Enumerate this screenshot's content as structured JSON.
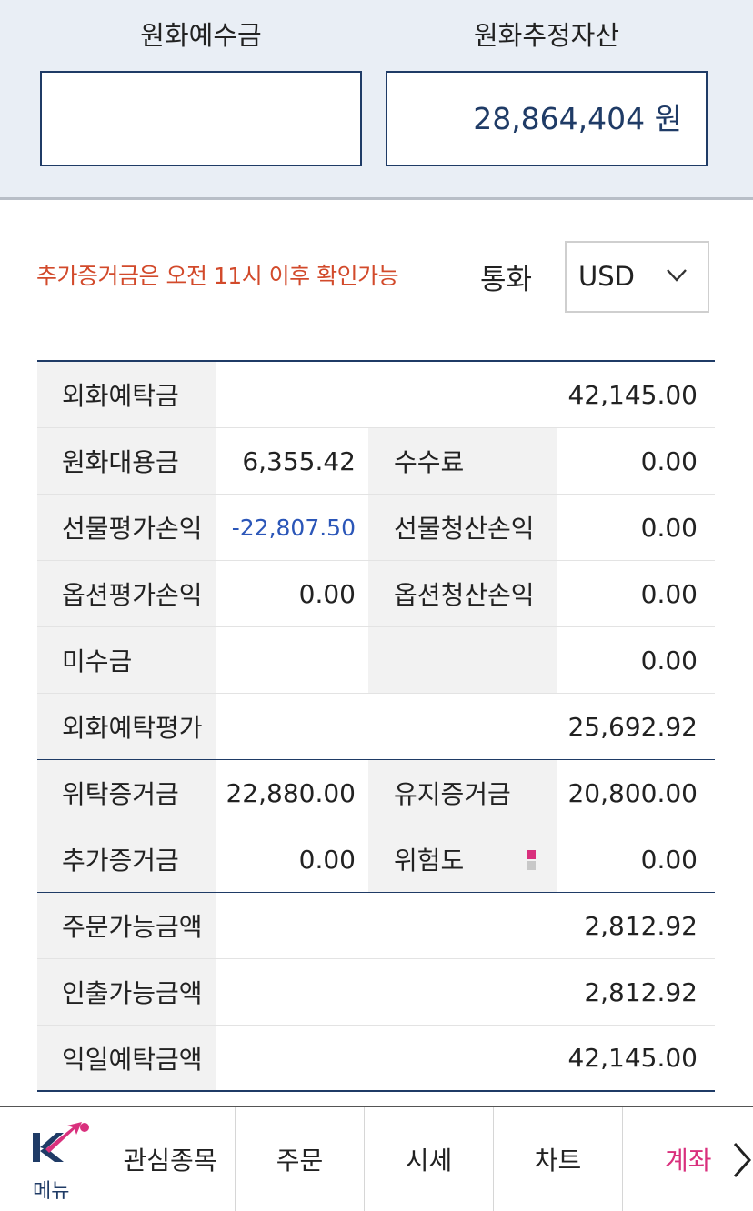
{
  "summary": {
    "krw_deposit_label": "원화예수금",
    "krw_deposit_value": "",
    "krw_est_assets_label": "원화추정자산",
    "krw_est_assets_value": "28,864,404 원"
  },
  "currency_bar": {
    "notice": "추가증거금은 오전 11시 이후 확인가능",
    "label": "통화",
    "selected": "USD",
    "notice_color": "#d24a2b"
  },
  "table": {
    "foreign_deposit": {
      "label": "외화예탁금",
      "value": "42,145.00"
    },
    "krw_substitute": {
      "label": "원화대용금",
      "value": "6,355.42"
    },
    "fee": {
      "label": "수수료",
      "value": "0.00"
    },
    "futures_eval_pl": {
      "label": "선물평가손익",
      "value": "-22,807.50"
    },
    "futures_settle_pl": {
      "label": "선물청산손익",
      "value": "0.00"
    },
    "options_eval_pl": {
      "label": "옵션평가손익",
      "value": "0.00"
    },
    "options_settle_pl": {
      "label": "옵션청산손익",
      "value": "0.00"
    },
    "unpaid": {
      "label": "미수금",
      "value": "0.00"
    },
    "foreign_deposit_eval": {
      "label": "외화예탁평가",
      "value": "25,692.92"
    },
    "initial_margin": {
      "label": "위탁증거금",
      "value": "22,880.00"
    },
    "maintenance_margin": {
      "label": "유지증거금",
      "value": "20,800.00"
    },
    "additional_margin": {
      "label": "추가증거금",
      "value": "0.00"
    },
    "risk": {
      "label": "위험도",
      "value": "0.00"
    },
    "orderable_amount": {
      "label": "주문가능금액",
      "value": "2,812.92"
    },
    "withdrawable_amount": {
      "label": "인출가능금액",
      "value": "2,812.92"
    },
    "next_day_deposit": {
      "label": "익일예탁금액",
      "value": "42,145.00"
    }
  },
  "nav": {
    "menu_label": "메뉴",
    "items": [
      {
        "label": "관심종목"
      },
      {
        "label": "주문"
      },
      {
        "label": "시세"
      },
      {
        "label": "차트"
      },
      {
        "label": "계좌"
      }
    ],
    "active_color": "#d9307d",
    "brand_color": "#1f3b66"
  }
}
